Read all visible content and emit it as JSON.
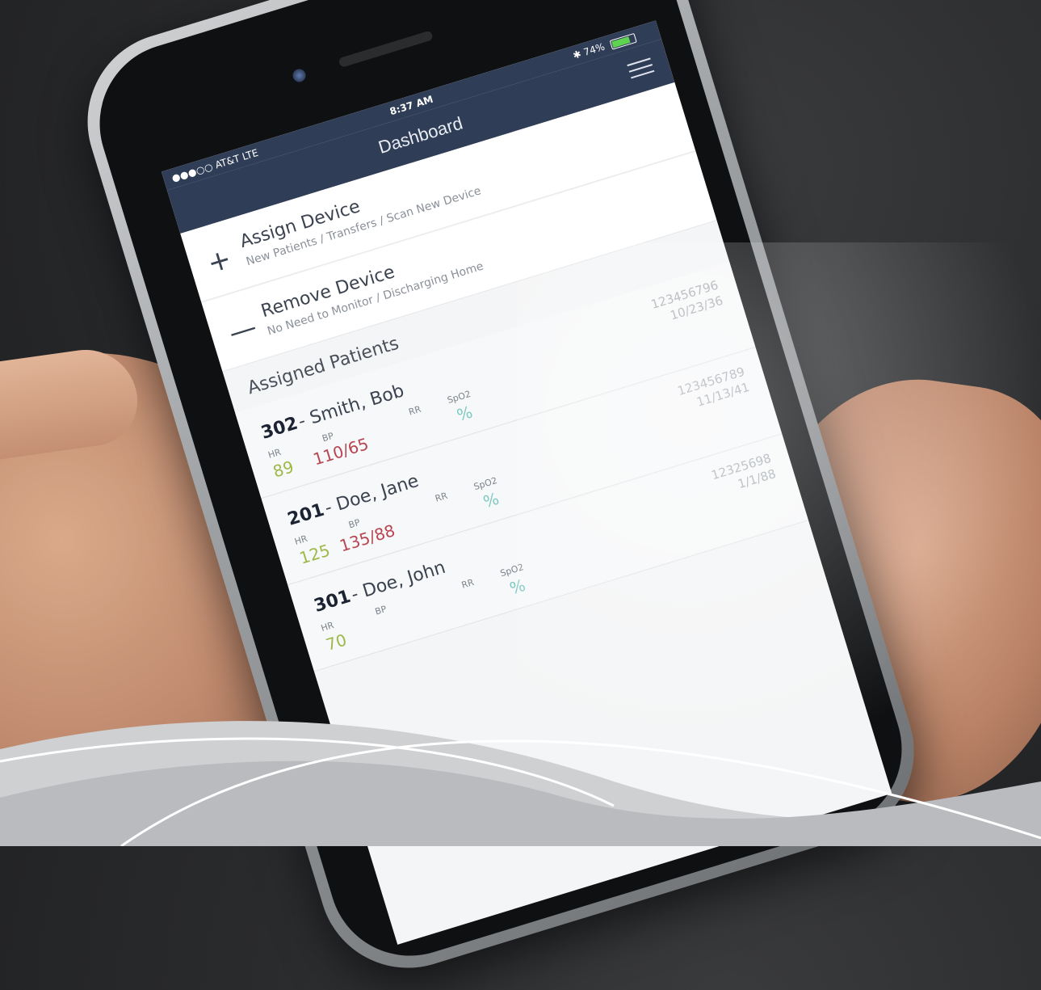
{
  "status_bar": {
    "carrier": "●●●○○ AT&T  LTE",
    "time": "8:37 AM",
    "bluetooth": "✱",
    "battery_percent": "74%",
    "battery_level": 0.74
  },
  "nav": {
    "title": "Dashboard",
    "menu_icon": "hamburger-menu-icon"
  },
  "actions": [
    {
      "symbol": "+",
      "title": "Assign Device",
      "subtitle": "New Patients / Transfers / Scan New Device"
    },
    {
      "symbol": "—",
      "title": "Remove Device",
      "subtitle": "No Need to Monitor / Discharging Home"
    }
  ],
  "assigned_title": "Assigned Patients",
  "vital_labels": {
    "hr": "HR",
    "bp": "BP",
    "rr": "RR",
    "spo2": "SpO2"
  },
  "patients": [
    {
      "room": "302",
      "name": "- Smith, Bob",
      "id": "123456796",
      "dob": "10/23/36",
      "hr": "89",
      "bp": "110/65",
      "rr": "",
      "spo2": "%"
    },
    {
      "room": "201",
      "name": "- Doe, Jane",
      "id": "123456789",
      "dob": "11/13/41",
      "hr": "125",
      "bp": "135/88",
      "rr": "",
      "spo2": "%"
    },
    {
      "room": "301",
      "name": "- Doe, John",
      "id": "12325698",
      "dob": "1/1/88",
      "hr": "70",
      "bp": "",
      "rr": "",
      "spo2": "%"
    }
  ],
  "colors": {
    "nav_bg": "#2f3d57",
    "hr": "#9fb84a",
    "bp": "#b74652",
    "spo2": "#7fc9c3",
    "battery": "#5fd24f"
  }
}
